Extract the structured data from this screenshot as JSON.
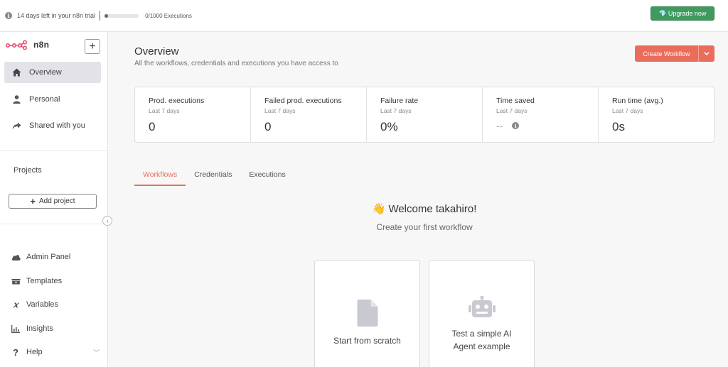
{
  "banner": {
    "trial_text": "14 days left in your n8n trial",
    "executions_text": "0/1000 Executions",
    "executions_used_fraction": 0.0,
    "upgrade_label": "Upgrade now"
  },
  "sidebar": {
    "logo_text": "n8n",
    "nav": [
      {
        "label": "Overview",
        "icon": "home-icon",
        "active": true
      },
      {
        "label": "Personal",
        "icon": "user-icon",
        "active": false
      },
      {
        "label": "Shared with you",
        "icon": "share-icon",
        "active": false
      }
    ],
    "projects_label": "Projects",
    "add_project_label": "Add project",
    "bottom": [
      {
        "label": "Admin Panel",
        "icon": "cloud-icon"
      },
      {
        "label": "Templates",
        "icon": "box-icon"
      },
      {
        "label": "Variables",
        "icon": "variable-icon"
      },
      {
        "label": "Insights",
        "icon": "chart-icon"
      },
      {
        "label": "Help",
        "icon": "question-icon"
      }
    ]
  },
  "main": {
    "title": "Overview",
    "subtitle": "All the workflows, credentials and executions you have access to",
    "create_workflow_label": "Create Workflow",
    "stats": [
      {
        "title": "Prod. executions",
        "period": "Last 7 days",
        "value": "0"
      },
      {
        "title": "Failed prod. executions",
        "period": "Last 7 days",
        "value": "0"
      },
      {
        "title": "Failure rate",
        "period": "Last 7 days",
        "value": "0%"
      },
      {
        "title": "Time saved",
        "period": "Last 7 days",
        "value": "--"
      },
      {
        "title": "Run time (avg.)",
        "period": "Last 7 days",
        "value": "0s"
      }
    ],
    "tabs": [
      "Workflows",
      "Credentials",
      "Executions"
    ],
    "active_tab": "Workflows",
    "welcome_title": "👋 Welcome takahiro!",
    "welcome_subtitle": "Create your first workflow",
    "cards": [
      {
        "label": "Start from scratch",
        "icon": "file-icon"
      },
      {
        "label_line1": "Test a simple AI",
        "label_line2": "Agent example",
        "icon": "robot-icon"
      }
    ]
  },
  "colors": {
    "accent": "#ea6d5b",
    "upgrade": "#3f9a5e",
    "active_nav_bg": "#e2e2e8"
  }
}
